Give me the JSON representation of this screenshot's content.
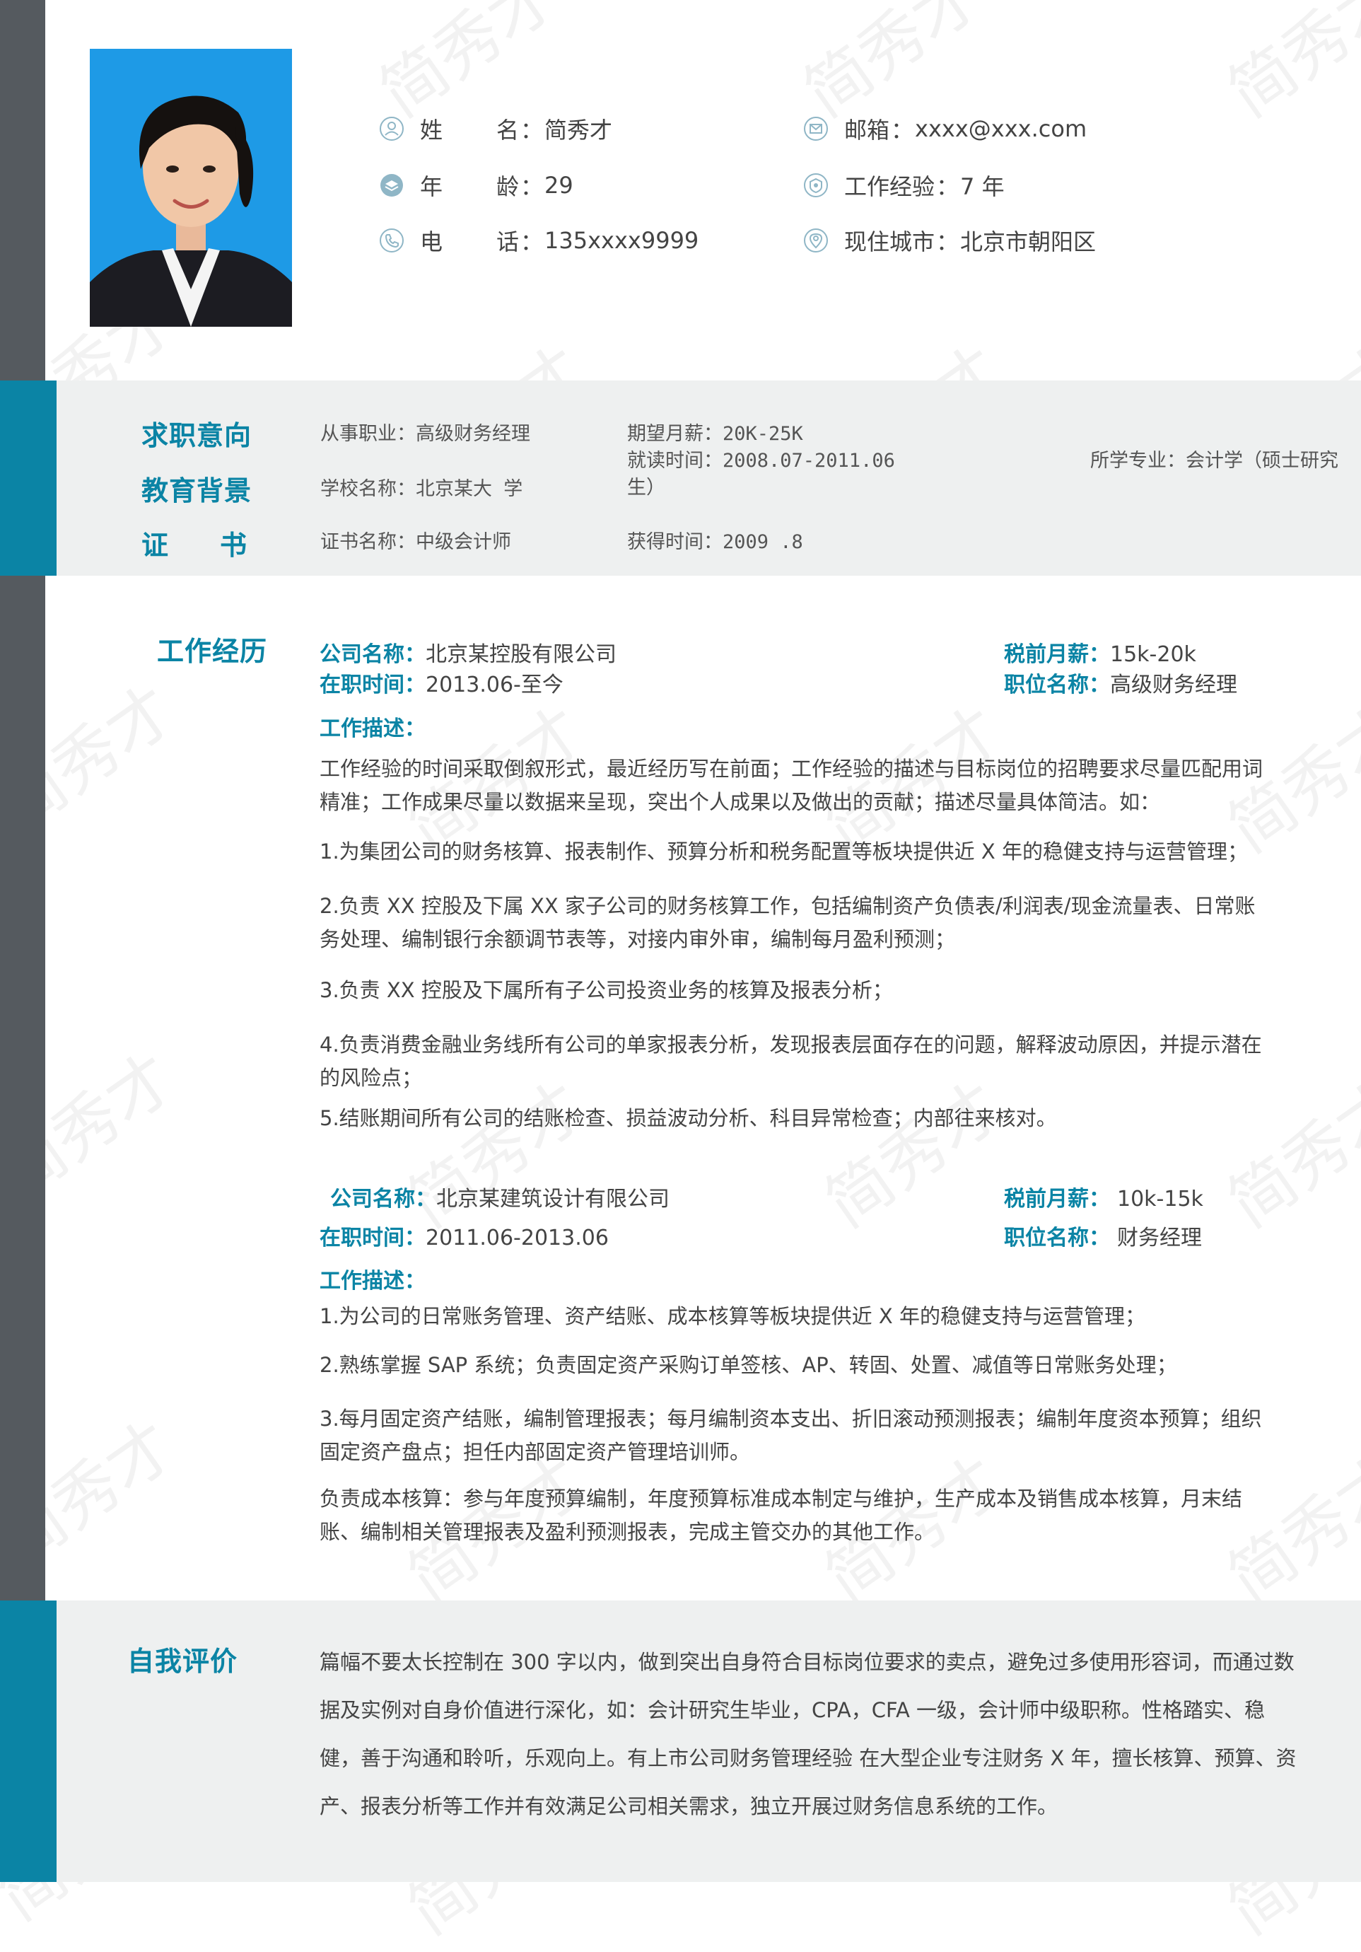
{
  "profile": {
    "photo_alt": "证件照",
    "name_label_1": "姓",
    "name_label_2": "名",
    "name_value": "简秀才",
    "age_label_1": "年",
    "age_label_2": "龄",
    "age_value": "29",
    "phone_label_1": "电",
    "phone_label_2": "话",
    "phone_value": "135xxxx9999",
    "email_label": "邮箱",
    "email_value": "xxxx@xxx.com",
    "experience_label": "工作经验",
    "experience_value": "7 年",
    "city_label": "现住城市",
    "city_value": "北京市朝阳区",
    "colon": "："
  },
  "intent": {
    "title": "求职意向",
    "position": "从事职业：高级财务经理",
    "salary": "期望月薪：20K-25K"
  },
  "education": {
    "title": "教育背景",
    "school": "学校名称：北京某大 学",
    "period_line1": "就读时间：2008.07-2011.06",
    "period_line2": "生）",
    "major": "所学专业：会计学（硕士研究"
  },
  "certificate": {
    "title_1": "证",
    "title_2": "书",
    "name": "证书名称：中级会计师",
    "time": "获得时间：2009   .8"
  },
  "work": {
    "title": "工作经历",
    "jobs": [
      {
        "company_label": "公司名称：",
        "company": "北京某控股有限公司",
        "period_label": "在职时间：",
        "period": "2013.06-至今",
        "salary_label": "税前月薪：",
        "salary": "15k-20k",
        "position_label": "职位名称：",
        "position": "高级财务经理",
        "desc_label": "工作描述：",
        "paragraphs": [
          "工作经验的时间采取倒叙形式，最近经历写在前面；工作经验的描述与目标岗位的招聘要求尽量匹配用词精准；工作成果尽量以数据来呈现，突出个人成果以及做出的贡献；描述尽量具体简洁。如：",
          "1.为集团公司的财务核算、报表制作、预算分析和税务配置等板块提供近 X 年的稳健支持与运营管理；",
          "2.负责 XX 控股及下属 XX 家子公司的财务核算工作，包括编制资产负债表/利润表/现金流量表、日常账务处理、编制银行余额调节表等，对接内审外审，编制每月盈利预测；",
          "3.负责 XX 控股及下属所有子公司投资业务的核算及报表分析；",
          "4.负责消费金融业务线所有公司的单家报表分析，发现报表层面存在的问题，解释波动原因，并提示潜在的风险点；",
          "5.结账期间所有公司的结账检查、损益波动分析、科目异常检查；内部往来核对。"
        ]
      },
      {
        "company_label": "公司名称：",
        "company": "北京某建筑设计有限公司",
        "period_label": "在职时间：",
        "period": "2011.06-2013.06",
        "salary_label": "税前月薪：",
        "salary": "10k-15k",
        "position_label": "职位名称：",
        "position": "财务经理",
        "desc_label": "工作描述：",
        "paragraphs": [
          "1.为公司的日常账务管理、资产结账、成本核算等板块提供近 X 年的稳健支持与运营管理；",
          "2.熟练掌握 SAP 系统；负责固定资产采购订单签核、AP、转固、处置、减值等日常账务处理；",
          "3.每月固定资产结账，编制管理报表；每月编制资本支出、折旧滚动预测报表；编制年度资本预算；组织固定资产盘点；担任内部固定资产管理培训师。",
          "负责成本核算：参与年度预算编制，年度预算标准成本制定与维护，生产成本及销售成本核算，月末结账、编制相关管理报表及盈利预测报表，完成主管交办的其他工作。"
        ]
      }
    ]
  },
  "self_eval": {
    "title": "自我评价",
    "text": "篇幅不要太长控制在 300 字以内，做到突出自身符合目标岗位要求的卖点，避免过多使用形容词，而通过数据及实例对自身价值进行深化，如：会计研究生毕业，CPA，CFA 一级，会计师中级职称。性格踏实、稳健，善于沟通和聆听，乐观向上。有上市公司财务管理经验 在大型企业专注财务 X 年，擅长核算、预算、资产、报表分析等工作并有效满足公司相关需求，独立开展过财务信息系统的工作。"
  },
  "watermark_text": "简秀才",
  "colors": {
    "accent": "#0b84a5",
    "sidebar": "#555a5f",
    "band": "#eef0f0"
  }
}
